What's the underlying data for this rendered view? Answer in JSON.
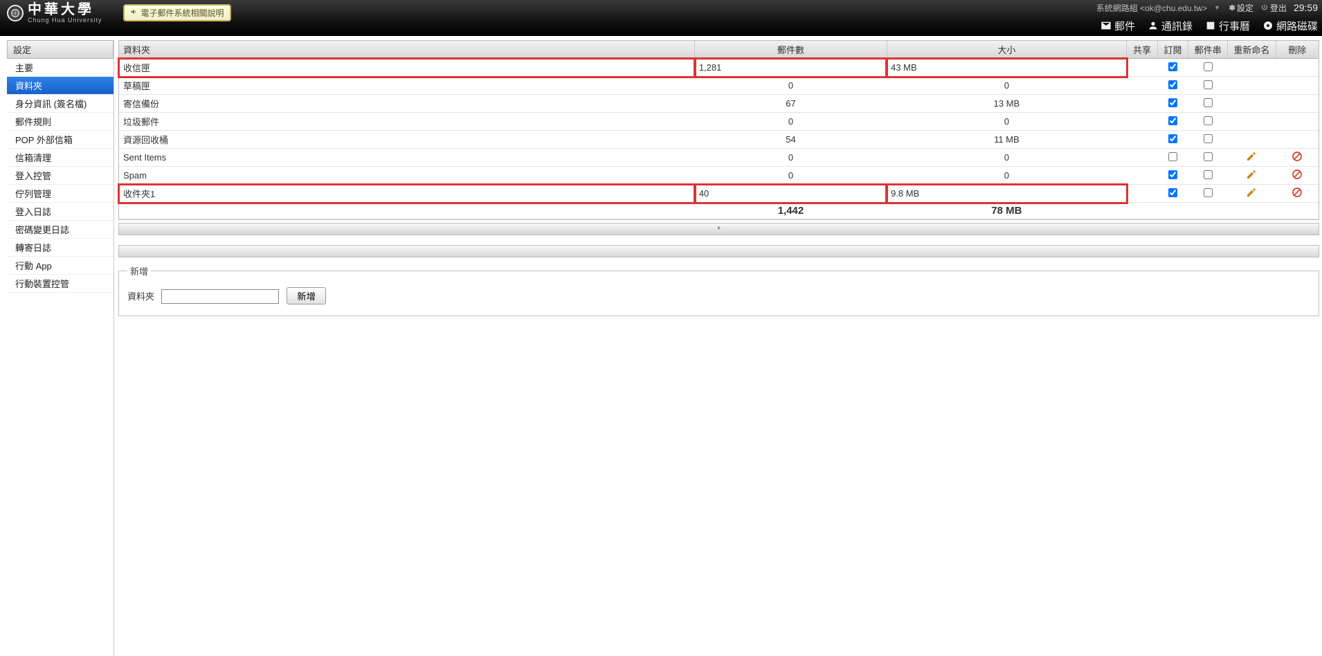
{
  "header": {
    "logo_zh": "中華大學",
    "logo_en": "Chung Hua University",
    "badge_label": "電子郵件系統相關說明",
    "user_info": "系統網路組 <ok@chu.edu.tw>",
    "settings_label": "設定",
    "logout_label": "登出",
    "time": "29:59",
    "nav": {
      "mail": "郵件",
      "contacts": "通訊錄",
      "calendar": "行事曆",
      "netdisk": "網路磁碟"
    }
  },
  "sidebar": {
    "title": "設定",
    "items": [
      {
        "label": "主要"
      },
      {
        "label": "資料夾",
        "active": true
      },
      {
        "label": "身分資訊 (簽名檔)"
      },
      {
        "label": "郵件規則"
      },
      {
        "label": "POP 外部信箱"
      },
      {
        "label": "信箱清理"
      },
      {
        "label": "登入控管"
      },
      {
        "label": "佇列管理"
      },
      {
        "label": "登入日誌"
      },
      {
        "label": "密碼變更日誌"
      },
      {
        "label": "轉寄日誌"
      },
      {
        "label": "行動 App"
      },
      {
        "label": "行動裝置控管"
      }
    ]
  },
  "table": {
    "headers": {
      "folder": "資料夾",
      "count": "郵件數",
      "size": "大小",
      "share": "共享",
      "subscribe": "訂閱",
      "thread": "郵件串",
      "rename": "重新命名",
      "delete": "刪除"
    },
    "rows": [
      {
        "name": "收信匣",
        "count": "1,281",
        "size": "43 MB",
        "subscribe": true,
        "thread": false,
        "rename": false,
        "del": false,
        "highlight": true
      },
      {
        "name": "草稿匣",
        "count": "0",
        "size": "0",
        "subscribe": true,
        "thread": false,
        "rename": false,
        "del": false,
        "highlight": false
      },
      {
        "name": "寄信備份",
        "count": "67",
        "size": "13 MB",
        "subscribe": true,
        "thread": false,
        "rename": false,
        "del": false,
        "highlight": false
      },
      {
        "name": "垃圾郵件",
        "count": "0",
        "size": "0",
        "subscribe": true,
        "thread": false,
        "rename": false,
        "del": false,
        "highlight": false
      },
      {
        "name": "資源回收桶",
        "count": "54",
        "size": "11 MB",
        "subscribe": true,
        "thread": false,
        "rename": false,
        "del": false,
        "highlight": false
      },
      {
        "name": "Sent Items",
        "count": "0",
        "size": "0",
        "subscribe": false,
        "thread": false,
        "rename": true,
        "del": true,
        "highlight": false
      },
      {
        "name": "Spam",
        "count": "0",
        "size": "0",
        "subscribe": true,
        "thread": false,
        "rename": true,
        "del": true,
        "highlight": false
      },
      {
        "name": "收件夾1",
        "count": "40",
        "size": "9.8 MB",
        "subscribe": true,
        "thread": false,
        "rename": true,
        "del": true,
        "highlight": true
      }
    ],
    "totals": {
      "count": "1,442",
      "size": "78 MB"
    }
  },
  "create": {
    "legend": "新增",
    "field_label": "資料夾",
    "button": "新增"
  }
}
